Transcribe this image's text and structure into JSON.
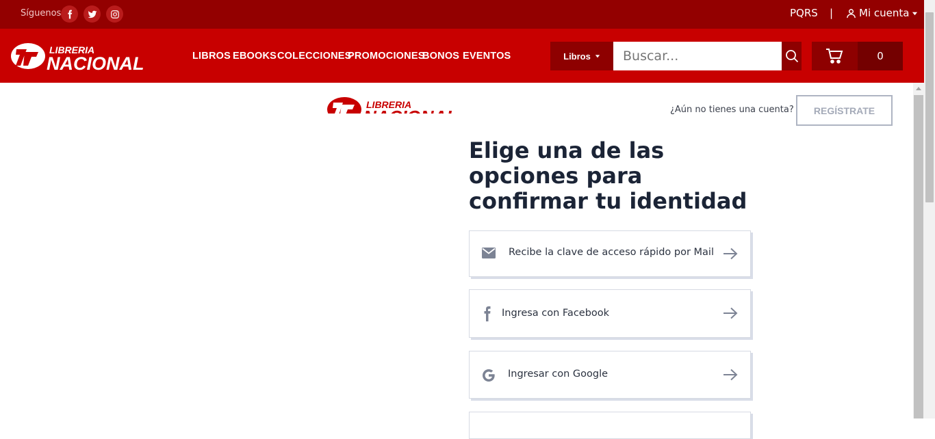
{
  "topbar": {
    "follow_label": "Síguenos",
    "social": [
      "facebook-icon",
      "twitter-icon",
      "instagram-icon"
    ],
    "pqrs": "PQRS",
    "separator": "|",
    "account_label": "Mi cuenta"
  },
  "navbar": {
    "logo_top": "LIBRERIA",
    "logo_bottom": "NACIONAL",
    "items": [
      "LIBROS",
      "EBOOKS",
      "COLECCIONES",
      "PROMOCIONES",
      "BONOS",
      "EVENTOS"
    ],
    "search_category": "Libros",
    "search_placeholder": "Buscar...",
    "cart_count": "0"
  },
  "content": {
    "logo_top": "LIBRERIA",
    "logo_bottom": "NACIONAL",
    "no_account_text": "¿Aún no tienes una cuenta?",
    "register_label": "REGÍSTRATE",
    "heading": "Elige una de las opciones para confirmar tu identidad",
    "options": [
      {
        "icon": "mail-icon",
        "label": "Recibe la clave de acceso rápido por Mail"
      },
      {
        "icon": "facebook-icon",
        "label": "Ingresa con Facebook"
      },
      {
        "icon": "google-icon",
        "label": "Ingresar con Google"
      }
    ]
  },
  "colors": {
    "topbar": "#930000",
    "navbar": "#c80000",
    "dark_accent": "#8e0000",
    "heading": "#1b2436"
  }
}
